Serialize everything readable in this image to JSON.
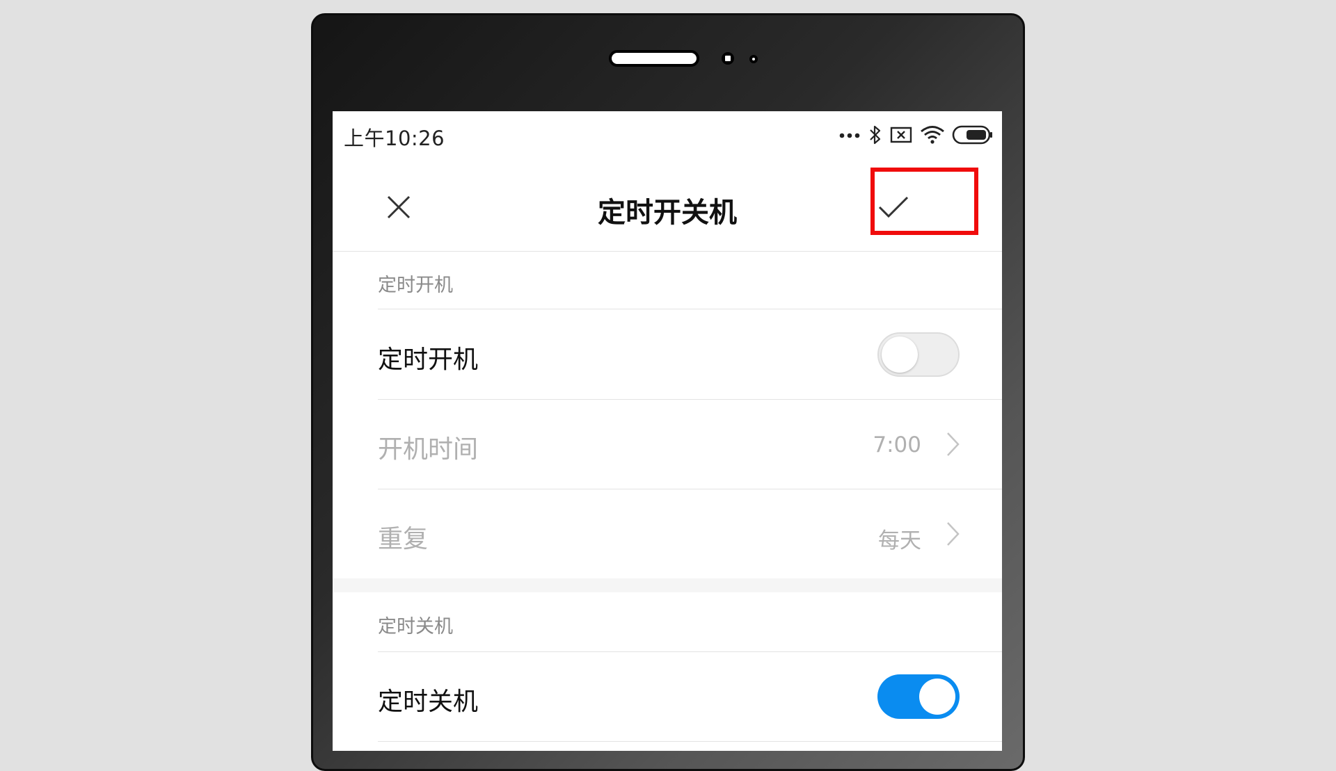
{
  "status_bar": {
    "time": "上午10:26",
    "icons": [
      "more-dots-icon",
      "bluetooth-icon",
      "sim-card-x-icon",
      "wifi-icon",
      "battery-icon"
    ]
  },
  "app_bar": {
    "title": "定时开关机",
    "close_icon": "close-icon",
    "confirm_icon": "checkmark-icon"
  },
  "highlight_color": "#f00c0c",
  "accent_color": "#0a8cf0",
  "power_on_section": {
    "header": "定时开机",
    "toggle_label": "定时开机",
    "toggle_on": false,
    "time_label": "开机时间",
    "time_value": "7:00",
    "repeat_label": "重复",
    "repeat_value": "每天"
  },
  "power_off_section": {
    "header": "定时关机",
    "toggle_label": "定时关机",
    "toggle_on": true
  }
}
